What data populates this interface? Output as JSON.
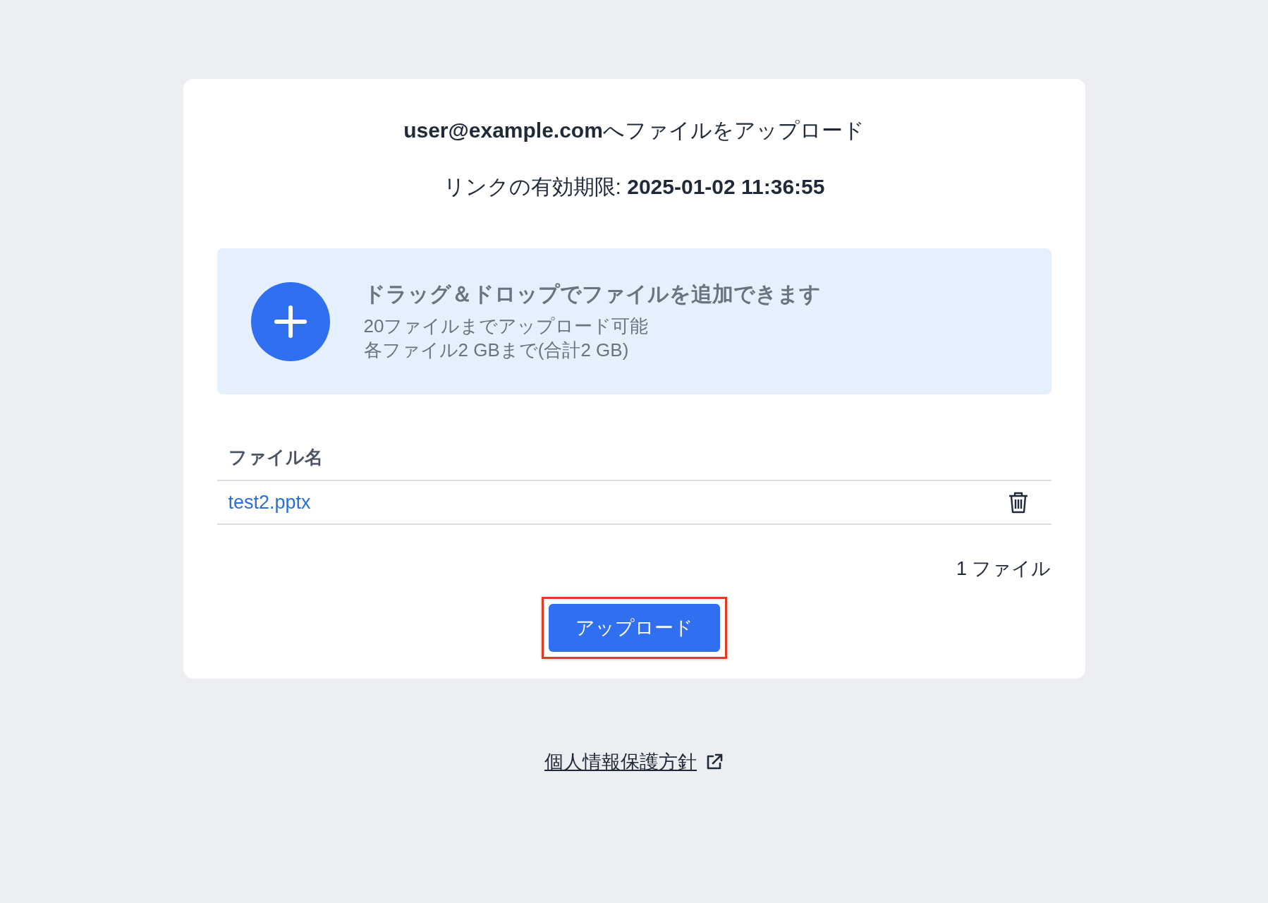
{
  "header": {
    "title": "**user@example.com**へファイルをアップロード",
    "expiry": "リンクの有効期限: **2025-01-02 11:36:55**"
  },
  "dropzone": {
    "heading": "ドラッグ＆ドロップでファイルを追加できます",
    "lines": [
      "20ファイルまでアップロード可能",
      "各ファイル2 GBまで(合計2 GB)"
    ]
  },
  "table": {
    "columns": [
      "ファイル名"
    ],
    "rows": [
      {
        "name": "test2.pptx"
      }
    ]
  },
  "file_count": "1 ファイル",
  "upload_button": {
    "label": "アップロード",
    "highlighted": true
  },
  "footer": {
    "privacy_link": "個人情報保護方針"
  }
}
